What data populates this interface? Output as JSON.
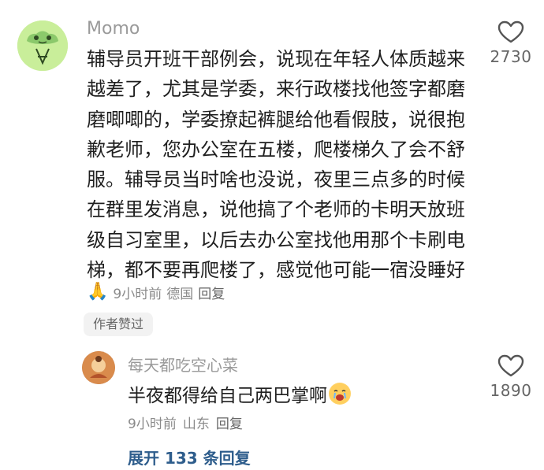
{
  "comment": {
    "username": "Momo",
    "text": "辅导员开班干部例会，说现在年轻人体质越来越差了，尤其是学委，来行政楼找他签字都磨磨唧唧的，学委撩起裤腿给他看假肢，说很抱歉老师，您办公室在五楼，爬楼梯久了会不舒服。辅导员当时啥也没说，夜里三点多的时候在群里发消息，说他搞了个老师的卡明天放班级自习室里，以后去办公室找他用那个卡刷电梯，都不要再爬楼了，感觉他可能一宿没睡好",
    "emoji": "🙏",
    "time": "9小时前",
    "location": "德国",
    "reply_label": "回复",
    "author_badge": "作者赞过",
    "like_count": "2730"
  },
  "reply": {
    "username": "每天都吃空心菜",
    "text": "半夜都得给自己两巴掌啊",
    "time": "9小时前",
    "location": "山东",
    "reply_label": "回复",
    "like_count": "1890"
  },
  "expand_label": "展开 133 条回复",
  "colors": {
    "text": "#1f1f1f",
    "meta": "#8a8a8a",
    "link": "#2e5d8c",
    "avatar_bg": "#c9ee9a",
    "badge_bg": "#f2f2f2"
  },
  "icons": [
    "frog-avatar",
    "heart-icon",
    "pray-emoji",
    "crying-face-emoji"
  ]
}
